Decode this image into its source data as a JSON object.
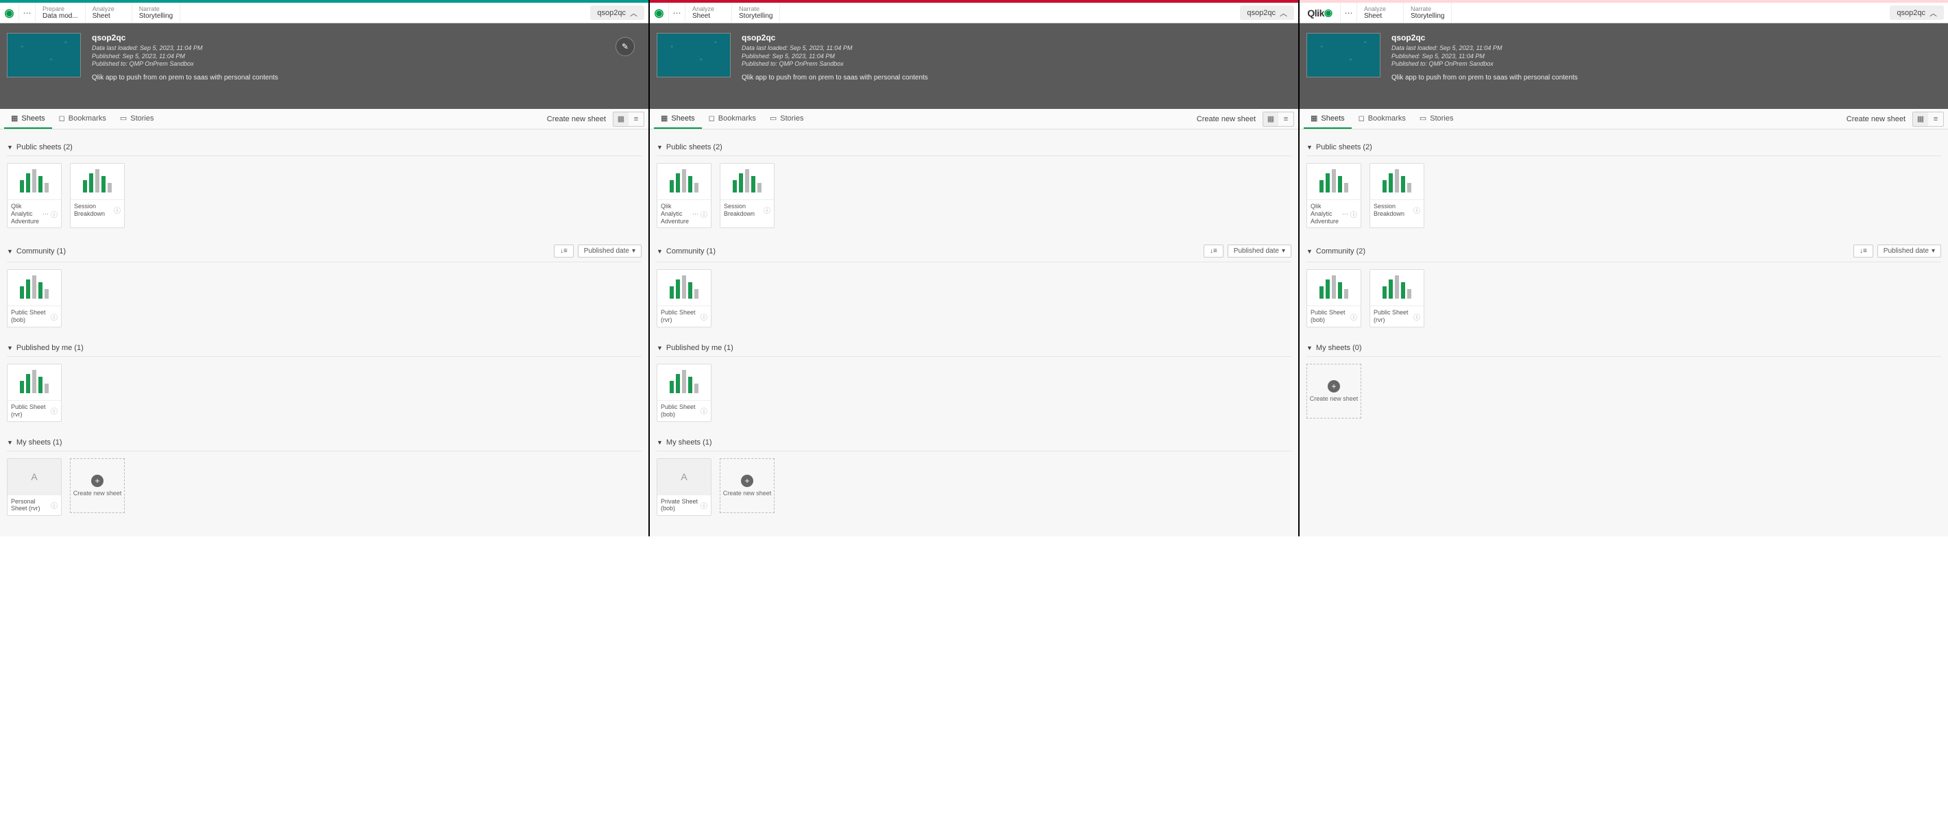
{
  "panes": [
    {
      "accent": "teal",
      "logo_style": "small",
      "nav": [
        {
          "top": "Prepare",
          "bottom": "Data mod..."
        },
        {
          "top": "Analyze",
          "bottom": "Sheet"
        },
        {
          "top": "Narrate",
          "bottom": "Storytelling"
        }
      ],
      "dropdown": "qsop2qc",
      "app": {
        "title": "qsop2qc",
        "meta1": "Data last loaded: Sep 5, 2023, 11:04 PM",
        "meta2": "Published: Sep 5, 2023, 11:04 PM",
        "meta3": "Published to: QMP OnPrem Sandbox",
        "desc": "Qlik app to push from on prem to saas with personal contents",
        "show_edit": true
      },
      "tabs": {
        "sheets": "Sheets",
        "bookmarks": "Bookmarks",
        "stories": "Stories"
      },
      "create_label": "Create new sheet",
      "sections": [
        {
          "title": "Public sheets (2)",
          "tools": false,
          "cards": [
            {
              "type": "chart",
              "label": "Qlik Analytic Adventure",
              "dots": true,
              "info": true
            },
            {
              "type": "chart",
              "label": "Session Breakdown",
              "info": true
            }
          ]
        },
        {
          "title": "Community (1)",
          "tools": true,
          "sort_label": "Published date",
          "cards": [
            {
              "type": "chart",
              "label": "Public Sheet (bob)",
              "info": true
            }
          ]
        },
        {
          "title": "Published by me (1)",
          "tools": false,
          "cards": [
            {
              "type": "chart",
              "label": "Public Sheet (rvr)",
              "info": true
            }
          ]
        },
        {
          "title": "My sheets (1)",
          "tools": false,
          "cards": [
            {
              "type": "letter",
              "letter": "A",
              "label": "Personal Sheet (rvr)",
              "info": true
            }
          ],
          "new_card": "Create new sheet"
        }
      ]
    },
    {
      "accent": "red",
      "logo_style": "small",
      "nav": [
        {
          "top": "Analyze",
          "bottom": "Sheet"
        },
        {
          "top": "Narrate",
          "bottom": "Storytelling"
        }
      ],
      "dropdown": "qsop2qc",
      "app": {
        "title": "qsop2qc",
        "meta1": "Data last loaded: Sep 5, 2023, 11:04 PM",
        "meta2": "Published: Sep 5, 2023, 11:04 PM",
        "meta3": "Published to: QMP OnPrem Sandbox",
        "desc": "Qlik app to push from on prem to saas with personal contents",
        "show_edit": false
      },
      "tabs": {
        "sheets": "Sheets",
        "bookmarks": "Bookmarks",
        "stories": "Stories"
      },
      "create_label": "Create new sheet",
      "sections": [
        {
          "title": "Public sheets (2)",
          "tools": false,
          "cards": [
            {
              "type": "chart",
              "label": "Qlik Analytic Adventure",
              "dots": true,
              "info": true
            },
            {
              "type": "chart",
              "label": "Session Breakdown",
              "info": true
            }
          ]
        },
        {
          "title": "Community (1)",
          "tools": true,
          "sort_label": "Published date",
          "cards": [
            {
              "type": "chart",
              "label": "Public Sheet (rvr)",
              "info": true
            }
          ]
        },
        {
          "title": "Published by me (1)",
          "tools": false,
          "cards": [
            {
              "type": "chart",
              "label": "Public Sheet (bob)",
              "info": true
            }
          ]
        },
        {
          "title": "My sheets (1)",
          "tools": false,
          "cards": [
            {
              "type": "letter",
              "letter": "A",
              "label": "Private Sheet (bob)",
              "info": true
            }
          ],
          "new_card": "Create new sheet"
        }
      ]
    },
    {
      "accent": "pink",
      "logo_style": "big",
      "logo_text": "Qlik",
      "nav": [
        {
          "top": "Analyze",
          "bottom": "Sheet"
        },
        {
          "top": "Narrate",
          "bottom": "Storytelling"
        }
      ],
      "dropdown": "qsop2qc",
      "app": {
        "title": "qsop2qc",
        "meta1": "Data last loaded: Sep 5, 2023, 11:04 PM",
        "meta2": "Published: Sep 5, 2023, 11:04 PM",
        "meta3": "Published to: QMP OnPrem Sandbox",
        "desc": "Qlik app to push from on prem to saas with personal contents",
        "show_edit": false
      },
      "tabs": {
        "sheets": "Sheets",
        "bookmarks": "Bookmarks",
        "stories": "Stories"
      },
      "create_label": "Create new sheet",
      "sections": [
        {
          "title": "Public sheets (2)",
          "tools": false,
          "cards": [
            {
              "type": "chart",
              "label": "Qlik Analytic Adventure",
              "dots": true,
              "info": true
            },
            {
              "type": "chart",
              "label": "Session Breakdown",
              "info": true
            }
          ]
        },
        {
          "title": "Community (2)",
          "tools": true,
          "sort_label": "Published date",
          "cards": [
            {
              "type": "chart",
              "label": "Public Sheet (bob)",
              "info": true
            },
            {
              "type": "chart",
              "label": "Public Sheet (rvr)",
              "info": true
            }
          ]
        },
        {
          "title": "My sheets (0)",
          "tools": false,
          "cards": [],
          "new_card": "Create new sheet"
        }
      ]
    }
  ]
}
